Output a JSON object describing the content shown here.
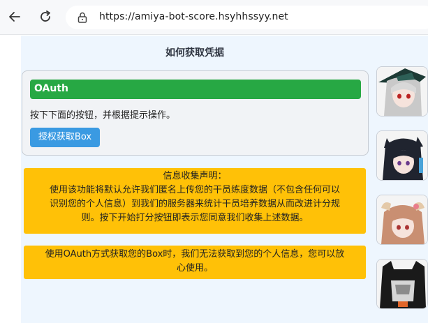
{
  "browser": {
    "url": "https://amiya-bot-score.hsyhhssyy.net"
  },
  "page": {
    "title": "如何获取凭据",
    "oauth": {
      "header": "OAuth",
      "description": "按下下面的按钮，并根据提示操作。",
      "button_label": "授权获取Box"
    },
    "notices": [
      {
        "line1": "信息收集声明：",
        "line2": "使用该功能将默认允许我们匿名上传您的干员练度数据（不包含任何可以",
        "line3": "识别您的个人信息）到我们的服务器来统计干员培养数据从而改进计分规",
        "line4": "则。按下开始打分按钮即表示您同意我们收集上述数据。"
      },
      {
        "line1": "使用OAuth方式获取您的Box时，我们无法获取到您的个人信息，您可以放",
        "line2": "心使用。"
      }
    ]
  },
  "colors": {
    "oauth_header_bg": "#27a844",
    "button_bg": "#3a9ae2",
    "notice_bg": "#ffc107",
    "page_bg": "#eef6fe"
  }
}
